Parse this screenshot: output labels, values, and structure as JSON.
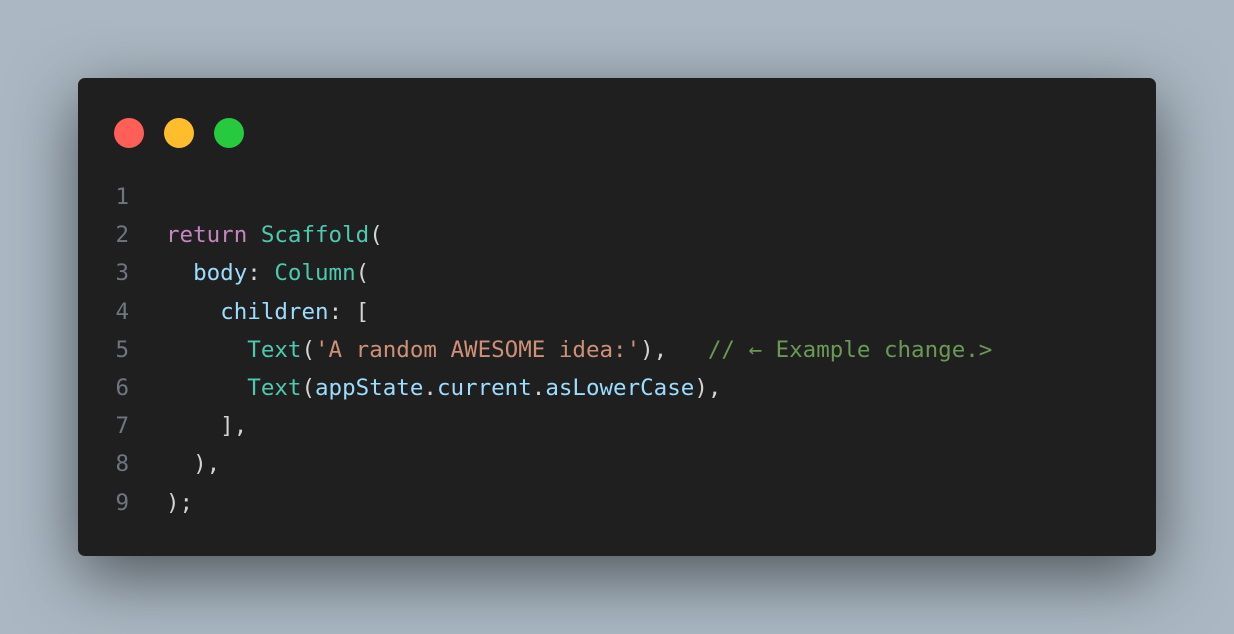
{
  "colors": {
    "background": "#abb8c3",
    "window": "#1f1f1f",
    "line_number": "#6e7681",
    "keyword": "#c586c0",
    "class": "#4ec9b0",
    "property": "#9cdcfe",
    "string": "#ce9178",
    "comment": "#6a9955",
    "punctuation": "#d4d4d4",
    "dot_red": "#ff5f56",
    "dot_yellow": "#ffbd2e",
    "dot_green": "#27c93f"
  },
  "window_controls": [
    "close-icon",
    "minimize-icon",
    "maximize-icon"
  ],
  "code": {
    "language": "dart",
    "lines": [
      {
        "number": "1",
        "tokens": []
      },
      {
        "number": "2",
        "tokens": [
          {
            "text": "return",
            "kind": "keyword"
          },
          {
            "text": " ",
            "kind": "punctuation"
          },
          {
            "text": "Scaffold",
            "kind": "class"
          },
          {
            "text": "(",
            "kind": "punctuation"
          }
        ]
      },
      {
        "number": "3",
        "tokens": [
          {
            "text": "  ",
            "kind": "punctuation"
          },
          {
            "text": "body",
            "kind": "property"
          },
          {
            "text": ": ",
            "kind": "punctuation"
          },
          {
            "text": "Column",
            "kind": "class"
          },
          {
            "text": "(",
            "kind": "punctuation"
          }
        ]
      },
      {
        "number": "4",
        "tokens": [
          {
            "text": "    ",
            "kind": "punctuation"
          },
          {
            "text": "children",
            "kind": "property"
          },
          {
            "text": ": [",
            "kind": "punctuation"
          }
        ]
      },
      {
        "number": "5",
        "tokens": [
          {
            "text": "      ",
            "kind": "punctuation"
          },
          {
            "text": "Text",
            "kind": "class"
          },
          {
            "text": "(",
            "kind": "punctuation"
          },
          {
            "text": "'A random AWESOME idea:'",
            "kind": "string"
          },
          {
            "text": "),   ",
            "kind": "punctuation"
          },
          {
            "text": "// ← Example change.>",
            "kind": "comment"
          }
        ]
      },
      {
        "number": "6",
        "tokens": [
          {
            "text": "      ",
            "kind": "punctuation"
          },
          {
            "text": "Text",
            "kind": "class"
          },
          {
            "text": "(",
            "kind": "punctuation"
          },
          {
            "text": "appState",
            "kind": "property"
          },
          {
            "text": ".",
            "kind": "punctuation"
          },
          {
            "text": "current",
            "kind": "property"
          },
          {
            "text": ".",
            "kind": "punctuation"
          },
          {
            "text": "asLowerCase",
            "kind": "property"
          },
          {
            "text": "),",
            "kind": "punctuation"
          }
        ]
      },
      {
        "number": "7",
        "tokens": [
          {
            "text": "    ],",
            "kind": "punctuation"
          }
        ]
      },
      {
        "number": "8",
        "tokens": [
          {
            "text": "  ),",
            "kind": "punctuation"
          }
        ]
      },
      {
        "number": "9",
        "tokens": [
          {
            "text": ");",
            "kind": "punctuation"
          }
        ]
      }
    ]
  }
}
